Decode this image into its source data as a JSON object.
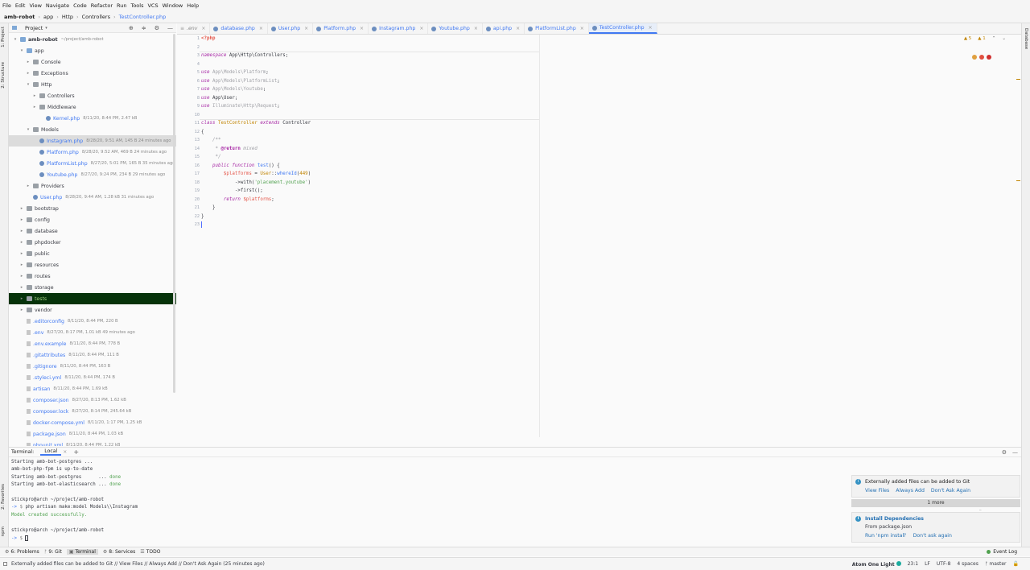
{
  "menu": [
    "File",
    "Edit",
    "View",
    "Navigate",
    "Code",
    "Refactor",
    "Run",
    "Tools",
    "VCS",
    "Window",
    "Help"
  ],
  "breadcrumb": [
    "amb-robot",
    "app",
    "Http",
    "Controllers",
    "TestController.php"
  ],
  "left_strip": {
    "project": "1: Project",
    "structure": "2: Structure",
    "favorites": "2: Favorites",
    "npm": "npm"
  },
  "right_strip": {
    "database": "Database"
  },
  "project_panel": {
    "title": "Project"
  },
  "tree": [
    {
      "name": "amb-robot",
      "meta": "~/project/amb-robot",
      "indent": 0,
      "type": "folder-blue",
      "arrow": "▾",
      "bold": true
    },
    {
      "name": "app",
      "meta": "",
      "indent": 1,
      "type": "folder-blue",
      "arrow": "▾"
    },
    {
      "name": "Console",
      "meta": "",
      "indent": 2,
      "type": "folder",
      "arrow": "▸"
    },
    {
      "name": "Exceptions",
      "meta": "",
      "indent": 2,
      "type": "folder",
      "arrow": "▸"
    },
    {
      "name": "Http",
      "meta": "",
      "indent": 2,
      "type": "folder",
      "arrow": "▾"
    },
    {
      "name": "Controllers",
      "meta": "",
      "indent": 3,
      "type": "folder",
      "arrow": "▸"
    },
    {
      "name": "Middleware",
      "meta": "",
      "indent": 3,
      "type": "folder",
      "arrow": "▸"
    },
    {
      "name": "Kernel.php",
      "meta": "8/11/20, 8:44 PM, 2.47 kB",
      "indent": 4,
      "type": "php",
      "arrow": "",
      "blue": true
    },
    {
      "name": "Models",
      "meta": "",
      "indent": 2,
      "type": "folder",
      "arrow": "▾"
    },
    {
      "name": "Instagram.php",
      "meta": "8/28/20, 9:51 AM, 145 B 24 minutes ago",
      "indent": 3,
      "type": "php",
      "arrow": "",
      "blue": true,
      "selected": true
    },
    {
      "name": "Platform.php",
      "meta": "8/28/20, 9:52 AM, 469 B 24 minutes ago",
      "indent": 3,
      "type": "php",
      "arrow": "",
      "blue": true
    },
    {
      "name": "PlatformList.php",
      "meta": "8/27/20, 5:01 PM, 165 B 35 minutes ago",
      "indent": 3,
      "type": "php",
      "arrow": "",
      "blue": true
    },
    {
      "name": "Youtube.php",
      "meta": "8/27/20, 9:24 PM, 234 B 29 minutes ago",
      "indent": 3,
      "type": "php",
      "arrow": "",
      "blue": true
    },
    {
      "name": "Providers",
      "meta": "",
      "indent": 2,
      "type": "folder",
      "arrow": "▸"
    },
    {
      "name": "User.php",
      "meta": "8/28/20, 9:44 AM, 1.28 kB 31 minutes ago",
      "indent": 2,
      "type": "php",
      "arrow": "",
      "blue": true
    },
    {
      "name": "bootstrap",
      "meta": "",
      "indent": 1,
      "type": "folder",
      "arrow": "▸"
    },
    {
      "name": "config",
      "meta": "",
      "indent": 1,
      "type": "folder",
      "arrow": "▸"
    },
    {
      "name": "database",
      "meta": "",
      "indent": 1,
      "type": "folder",
      "arrow": "▸"
    },
    {
      "name": "phpdocker",
      "meta": "",
      "indent": 1,
      "type": "folder",
      "arrow": "▸"
    },
    {
      "name": "public",
      "meta": "",
      "indent": 1,
      "type": "folder",
      "arrow": "▸"
    },
    {
      "name": "resources",
      "meta": "",
      "indent": 1,
      "type": "folder",
      "arrow": "▸"
    },
    {
      "name": "routes",
      "meta": "",
      "indent": 1,
      "type": "folder",
      "arrow": "▸"
    },
    {
      "name": "storage",
      "meta": "",
      "indent": 1,
      "type": "folder",
      "arrow": "▸"
    },
    {
      "name": "tests",
      "meta": "",
      "indent": 1,
      "type": "folder",
      "arrow": "▸",
      "highlight": true
    },
    {
      "name": "vendor",
      "meta": "",
      "indent": 1,
      "type": "folder",
      "arrow": "▸"
    },
    {
      "name": ".editorconfig",
      "meta": "8/11/20, 8:44 PM, 220 B",
      "indent": 1,
      "type": "file",
      "arrow": "",
      "blue": true
    },
    {
      "name": ".env",
      "meta": "8/27/20, 8:17 PM, 1.01 kB 49 minutes ago",
      "indent": 1,
      "type": "file",
      "arrow": "",
      "blue": true
    },
    {
      "name": ".env.example",
      "meta": "8/11/20, 8:44 PM, 778 B",
      "indent": 1,
      "type": "file",
      "arrow": "",
      "blue": true
    },
    {
      "name": ".gitattributes",
      "meta": "8/11/20, 8:44 PM, 111 B",
      "indent": 1,
      "type": "file",
      "arrow": "",
      "blue": true
    },
    {
      "name": ".gitignore",
      "meta": "8/11/20, 8:44 PM, 163 B",
      "indent": 1,
      "type": "file",
      "arrow": "",
      "blue": true
    },
    {
      "name": ".styleci.yml",
      "meta": "8/11/20, 8:44 PM, 174 B",
      "indent": 1,
      "type": "file",
      "arrow": "",
      "blue": true
    },
    {
      "name": "artisan",
      "meta": "8/11/20, 8:44 PM, 1.69 kB",
      "indent": 1,
      "type": "file",
      "arrow": "",
      "blue": true
    },
    {
      "name": "composer.json",
      "meta": "8/27/20, 8:13 PM, 1.62 kB",
      "indent": 1,
      "type": "file",
      "arrow": "",
      "blue": true
    },
    {
      "name": "composer.lock",
      "meta": "8/27/20, 8:14 PM, 245.64 kB",
      "indent": 1,
      "type": "file",
      "arrow": "",
      "blue": true
    },
    {
      "name": "docker-compose.yml",
      "meta": "8/11/20, 1:17 PM, 1.25 kB",
      "indent": 1,
      "type": "file",
      "arrow": "",
      "blue": true
    },
    {
      "name": "package.json",
      "meta": "8/11/20, 8:44 PM, 1.03 kB",
      "indent": 1,
      "type": "file",
      "arrow": "",
      "blue": true
    },
    {
      "name": "phpunit.xml",
      "meta": "8/11/20, 8:44 PM, 1.22 kB",
      "indent": 1,
      "type": "file",
      "arrow": "",
      "blue": true
    }
  ],
  "tabs": [
    {
      "name": ".env",
      "plain": true
    },
    {
      "name": "database.php"
    },
    {
      "name": "User.php"
    },
    {
      "name": "Platform.php"
    },
    {
      "name": "Instagram.php"
    },
    {
      "name": "Youtube.php"
    },
    {
      "name": "api.php"
    },
    {
      "name": "PlatformList.php"
    },
    {
      "name": "TestController.php",
      "active": true
    }
  ],
  "inspections": {
    "warnings": "▲ 5",
    "weak": "▲ 1"
  },
  "code_lines": [
    "<?php",
    "",
    "namespace App\\Http\\Controllers;",
    "",
    "use App\\Models\\Platform;",
    "use App\\Models\\PlatformList;",
    "use App\\Models\\Youtube;",
    "use App\\User;",
    "use Illuminate\\Http\\Request;",
    "",
    "class TestController extends Controller",
    "{",
    "    /**",
    "     * @return mixed",
    "     */",
    "    public function test() {",
    "        $platforms = User::whereId(449)",
    "            ->with('placement.youtube')",
    "            ->first();",
    "        return $platforms;",
    "    }",
    "}",
    ""
  ],
  "terminal": {
    "label": "Terminal:",
    "tab": "Local",
    "lines": [
      {
        "text": "Starting amb-bot-postgres ...",
        "ok": ""
      },
      {
        "text": "amb-bot-php-fpm is up-to-date",
        "ok": ""
      },
      {
        "text": "Starting amb-bot-postgres      ... ",
        "ok": "done"
      },
      {
        "text": "Starting amb-bot-elasticsearch ... ",
        "ok": "done"
      },
      {
        "text": "",
        "ok": ""
      },
      {
        "text": "stickpro@arch ~/project/amb-robot",
        "ok": ""
      },
      {
        "text": "-> $ php artisan make:model Models\\\\Instagram",
        "ok": ""
      },
      {
        "text": "Model created successfully.",
        "ok": ""
      },
      {
        "text": "",
        "ok": ""
      },
      {
        "text": "stickpro@arch ~/project/amb-robot",
        "ok": ""
      },
      {
        "text": "-> $ ",
        "ok": ""
      }
    ]
  },
  "notifications": [
    {
      "title": "Externally added files can be added to Git",
      "body": "",
      "actions": [
        "View Files",
        "Always Add",
        "Don't Ask Again"
      ],
      "bold": false
    },
    {
      "title": "Install Dependencies",
      "body": "From package.json",
      "actions": [
        "Run 'npm install'",
        "Don't ask again"
      ],
      "bold": true
    }
  ],
  "more_label": "1 more",
  "bottom_tools": [
    {
      "icon": "⚙",
      "label": "6: Problems"
    },
    {
      "icon": "ᚠ",
      "label": "9: Git"
    },
    {
      "icon": "▣",
      "label": "Terminal",
      "active": true
    },
    {
      "icon": "⚙",
      "label": "8: Services"
    },
    {
      "icon": "☰",
      "label": "TODO"
    }
  ],
  "event_log": "Event Log",
  "status": {
    "message": "Externally added files can be added to Git // View Files // Always Add // Don't Ask Again (25 minutes ago)",
    "theme": "Atom One Light",
    "position": "23:1",
    "line_sep": "LF",
    "encoding": "UTF-8",
    "indent": "4 spaces",
    "branch": "ᚠ master"
  },
  "colors": {
    "accent": "#4078f2",
    "highlight_row": "#06330a",
    "selected_row": "#dcdcdc"
  }
}
